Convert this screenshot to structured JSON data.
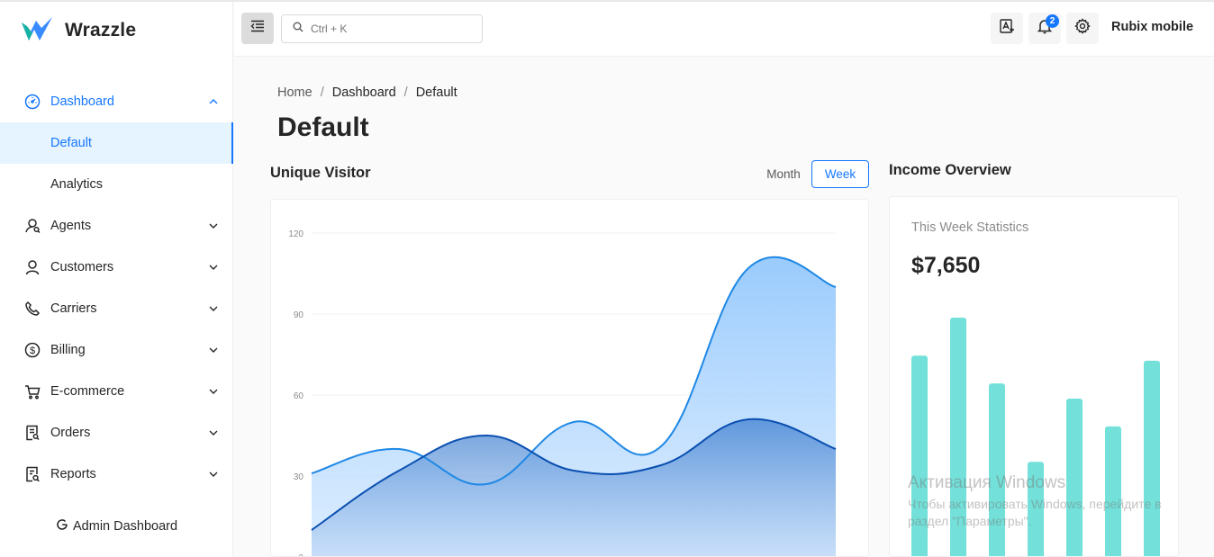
{
  "brand": {
    "name": "Wrazzle"
  },
  "colors": {
    "accent": "#1677ff",
    "selected_bg": "#e6f4ff",
    "bar": "#73e0d9",
    "series_light": "#8ec5fc",
    "series_dark": "#0a4fb0"
  },
  "sidebar": {
    "items": [
      {
        "label": "Dashboard",
        "icon": "dashboard-icon",
        "expanded": true
      },
      {
        "label": "Default",
        "selected": true
      },
      {
        "label": "Analytics"
      },
      {
        "label": "Agents",
        "icon": "agents-icon"
      },
      {
        "label": "Customers",
        "icon": "user-icon"
      },
      {
        "label": "Carriers",
        "icon": "phone-icon"
      },
      {
        "label": "Billing",
        "icon": "dollar-icon"
      },
      {
        "label": "E-commerce",
        "icon": "cart-icon"
      },
      {
        "label": "Orders",
        "icon": "orders-icon"
      },
      {
        "label": "Reports",
        "icon": "reports-icon"
      }
    ],
    "admin_link": "Admin Dashboard"
  },
  "header": {
    "search_placeholder": "Ctrl + K",
    "notification_count": "2",
    "user_name": "Rubix mobile"
  },
  "breadcrumb": {
    "items": [
      "Home",
      "Dashboard",
      "Default"
    ],
    "separator": "/"
  },
  "page": {
    "title": "Default"
  },
  "unique_visitor": {
    "title": "Unique Visitor",
    "toggle": {
      "month": "Month",
      "week": "Week",
      "selected": "Week"
    }
  },
  "income": {
    "title": "Income Overview",
    "stat_label": "This Week Statistics",
    "stat_value": "$7,650"
  },
  "watermark": {
    "line1": "Активация Windows",
    "line2": "Чтобы активировать Windows, перейдите в раздел \"Параметры\"."
  },
  "chart_data": [
    {
      "type": "area",
      "y_ticks": [
        "0",
        "30",
        "60",
        "90",
        "120"
      ],
      "ylim": [
        0,
        120
      ],
      "x": [
        0,
        1,
        2,
        3,
        4,
        5,
        6
      ],
      "series": [
        {
          "values": [
            31,
            40,
            27,
            50,
            41,
            107,
            100
          ]
        },
        {
          "values": [
            10,
            32,
            45,
            32,
            34,
            51,
            40
          ]
        }
      ],
      "grid": true
    },
    {
      "type": "bar",
      "values": [
        80,
        95,
        69,
        38,
        63,
        52,
        78
      ],
      "ylim": [
        0,
        100
      ]
    }
  ]
}
